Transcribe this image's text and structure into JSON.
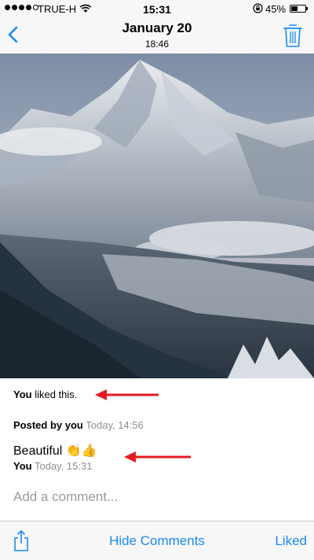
{
  "status_bar": {
    "carrier": "TRUE-H",
    "time": "15:31",
    "battery_percent": "45%",
    "battery_level": 0.45,
    "signal_bars_filled": 4,
    "signal_bars_total": 5,
    "icons": [
      "wifi-icon",
      "rotation-lock-icon",
      "battery-icon"
    ]
  },
  "nav": {
    "title": "January 20",
    "subtitle": "18:46",
    "back_icon": "chevron-left-icon",
    "delete_icon": "trash-icon"
  },
  "photo": {
    "subject": "snow-covered mountain peak with clouds and valley"
  },
  "activity": {
    "liked_by": "You",
    "liked_suffix": "liked this."
  },
  "post_info": {
    "label": "Posted by you",
    "timestamp": "Today, 14:56"
  },
  "comment": {
    "text": "Beautiful",
    "emoji": "👏👍",
    "author": "You",
    "timestamp": "Today, 15:31"
  },
  "add_comment": {
    "placeholder": "Add a comment..."
  },
  "toolbar": {
    "share_icon": "share-icon",
    "hide_comments_label": "Hide Comments",
    "liked_label": "Liked"
  },
  "colors": {
    "accent": "#1a8bf0",
    "arrow": "#e31b23",
    "meta_gray": "#8e8e93",
    "placeholder_gray": "#9b9b9f"
  }
}
